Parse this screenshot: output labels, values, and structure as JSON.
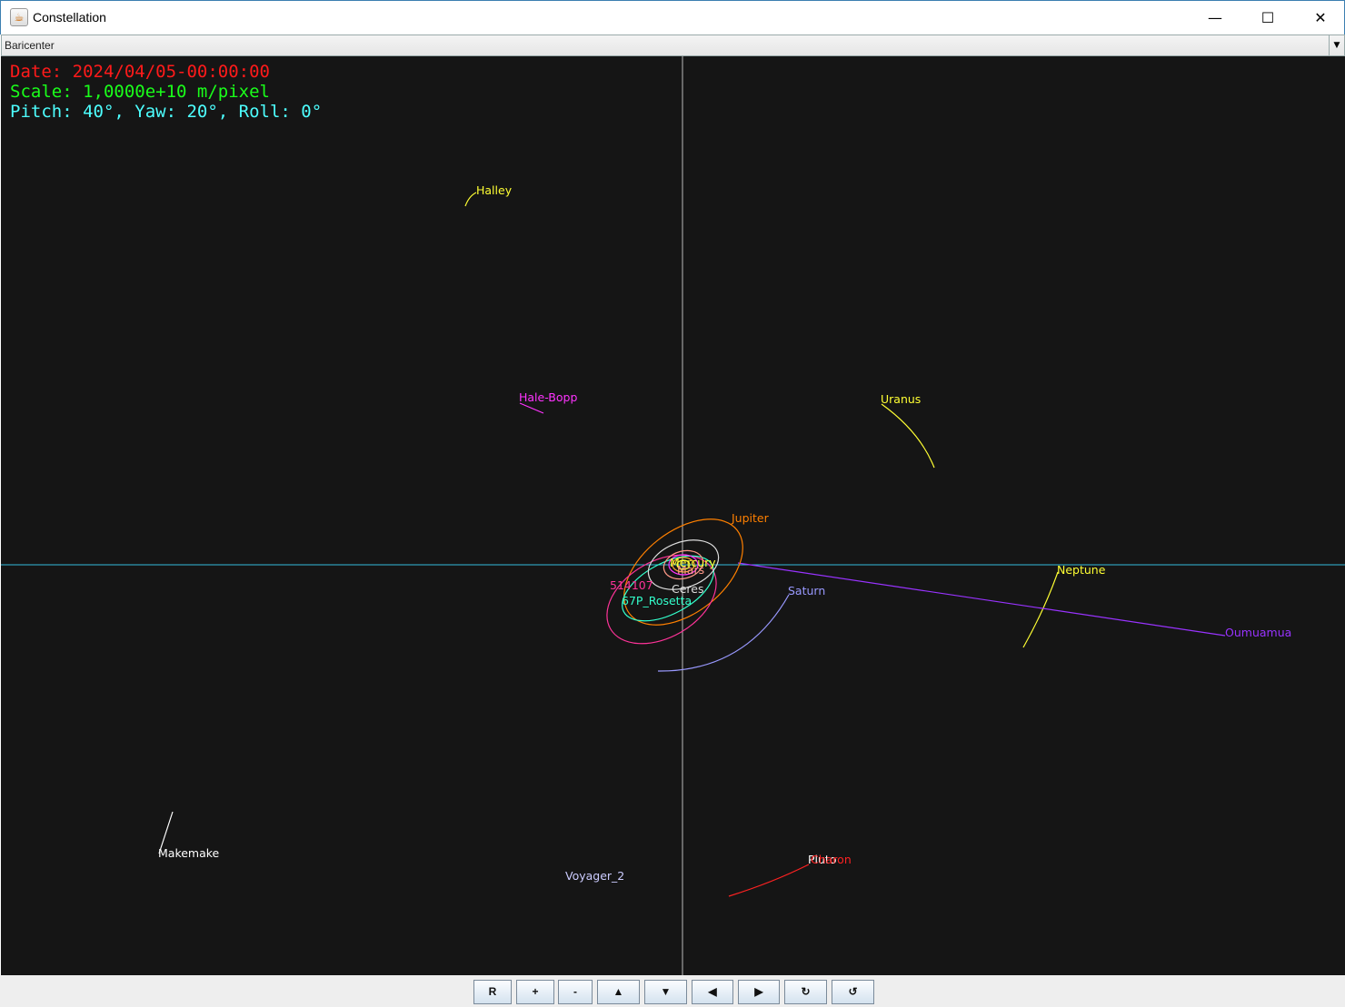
{
  "window": {
    "title": "Constellation",
    "icon": "java-cup-icon",
    "minimize": "—",
    "maximize": "☐",
    "close": "✕"
  },
  "center_selector": {
    "value": "Baricenter"
  },
  "hud": {
    "date": "Date: 2024/04/05-00:00:00",
    "scale": "Scale: 1,0000e+10 m/pixel",
    "orientation": "Pitch: 40°, Yaw: 20°, Roll: 0°",
    "colors": {
      "date": "#ff1a1a",
      "scale": "#1aff1a",
      "orientation": "#4dffff"
    }
  },
  "bodies": [
    {
      "name": "Halley",
      "color": "#ffff33"
    },
    {
      "name": "Hale-Bopp",
      "color": "#ff33ff"
    },
    {
      "name": "Uranus",
      "color": "#ffff33"
    },
    {
      "name": "Jupiter",
      "color": "#ff8000"
    },
    {
      "name": "Neptune",
      "color": "#ffff33"
    },
    {
      "name": "Saturn",
      "color": "#9999ff"
    },
    {
      "name": "Oumuamua",
      "color": "#9933ff"
    },
    {
      "name": "514107",
      "color": "#ff3399"
    },
    {
      "name": "67P_Rosetta",
      "color": "#33ffcc"
    },
    {
      "name": "Ceres",
      "color": "#dddddd"
    },
    {
      "name": "Mars",
      "color": "#ff9988"
    },
    {
      "name": "Mercury",
      "color": "#ffff33"
    },
    {
      "name": "Makemake",
      "color": "#ffffff"
    },
    {
      "name": "Voyager_2",
      "color": "#ccccff"
    },
    {
      "name": "Pluto",
      "color": "#ffffff"
    },
    {
      "name": "Charon",
      "color": "#ff2222"
    }
  ],
  "axes_color": "#33bbdd",
  "toolbar": {
    "buttons": [
      {
        "id": "reset",
        "label": "R"
      },
      {
        "id": "zoom-in",
        "label": "+"
      },
      {
        "id": "zoom-out",
        "label": "-"
      },
      {
        "id": "pitch-up",
        "label": "▲"
      },
      {
        "id": "pitch-down",
        "label": "▼"
      },
      {
        "id": "yaw-left",
        "label": "◀"
      },
      {
        "id": "yaw-right",
        "label": "▶"
      },
      {
        "id": "roll-cw",
        "label": "↻"
      },
      {
        "id": "roll-ccw",
        "label": "↺"
      }
    ]
  }
}
